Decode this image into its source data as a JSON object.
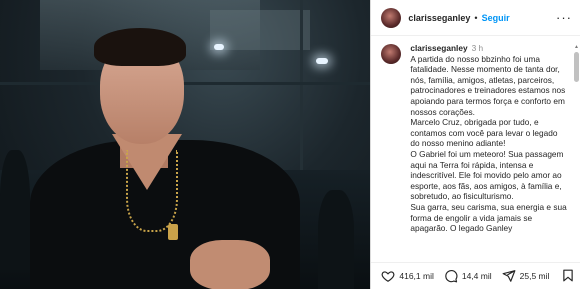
{
  "post": {
    "username": "clarisseganley",
    "follow_label": "Seguir",
    "separator": "•",
    "more_label": "···",
    "time": "3 h"
  },
  "caption": {
    "p1": "A partida do nosso bbzinho foi uma fatalidade. Nesse momento de tanta dor, nós, família, amigos, atletas, parceiros, patrocinadores e treinadores estamos nos apoiando para termos força e conforto em nossos corações.",
    "p2": "Marcelo Cruz, obrigada por tudo, e contamos com você para levar o legado do nosso menino adiante!",
    "p3": "O Gabriel foi um meteoro! Sua passagem aqui na Terra foi rápida, intensa e indescritível. Ele foi movido pelo amor ao esporte, aos fãs, aos amigos, à família e, sobretudo, ao fisiculturismo.",
    "p4": "Sua garra, seu carisma, sua energia e sua forma de engolir a vida jamais se apagarão. O legado Ganley"
  },
  "actions": {
    "likes": "416,1 mil",
    "comments": "14,4 mil",
    "shares": "25,5 mil"
  },
  "colors": {
    "accent": "#0095f6",
    "text": "#262626",
    "muted": "#8e8e8e"
  }
}
